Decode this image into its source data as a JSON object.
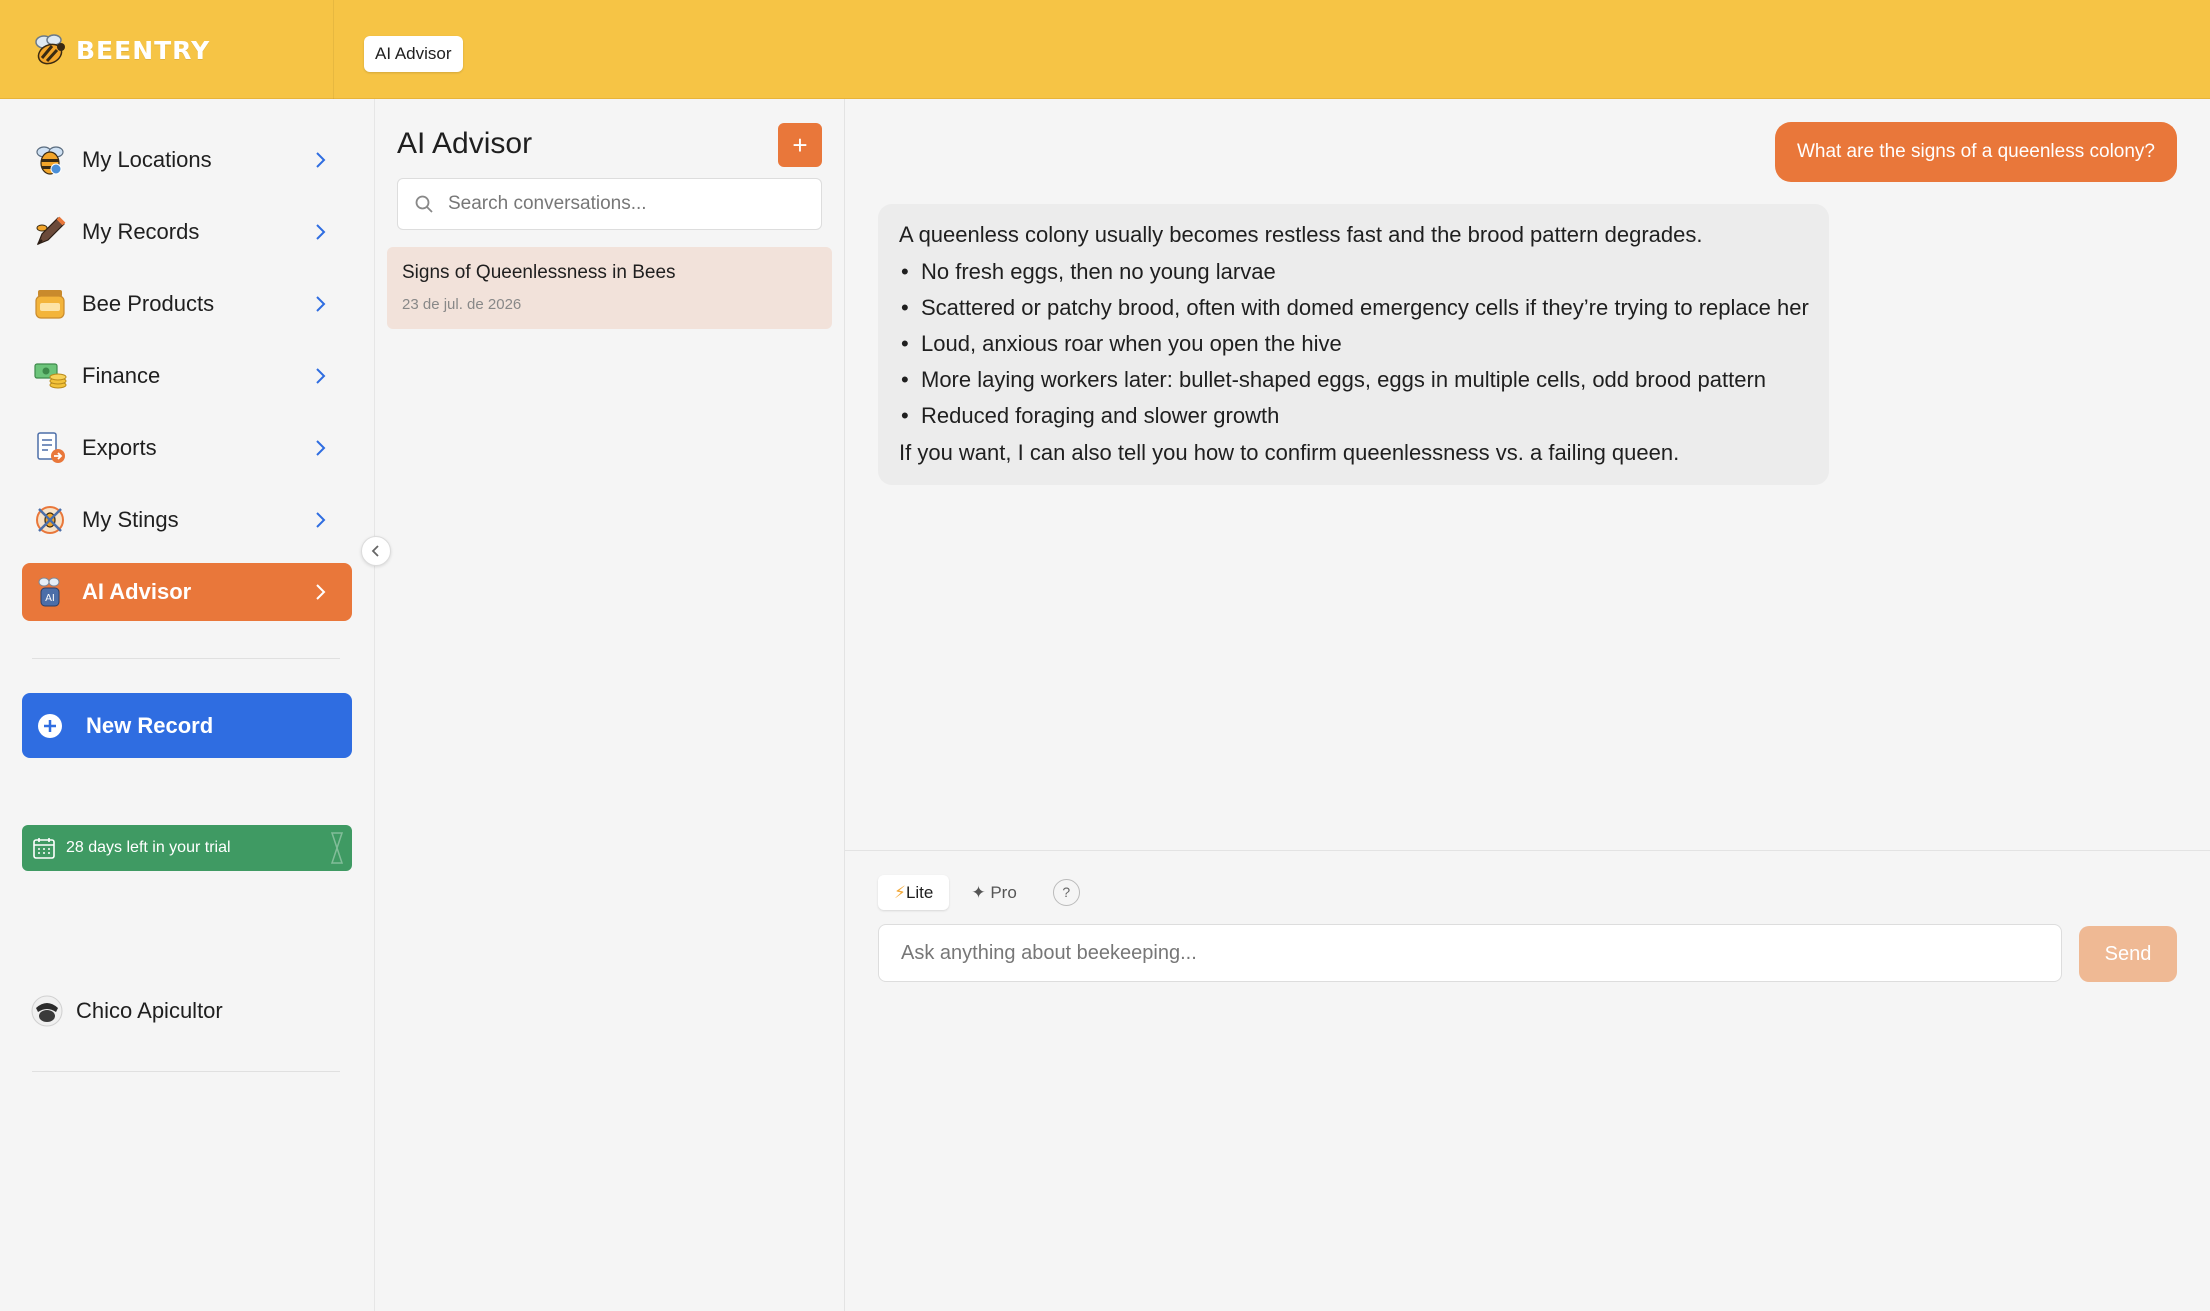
{
  "app": {
    "logo_text": "BEENTRY",
    "breadcrumb": "AI Advisor"
  },
  "sidebar": {
    "items": [
      {
        "label": "My Locations",
        "icon": "bee-map-icon"
      },
      {
        "label": "My Records",
        "icon": "pen-icon"
      },
      {
        "label": "Bee Products",
        "icon": "honey-jar-icon"
      },
      {
        "label": "Finance",
        "icon": "money-icon"
      },
      {
        "label": "Exports",
        "icon": "export-doc-icon"
      },
      {
        "label": "My Stings",
        "icon": "sting-icon"
      },
      {
        "label": "AI Advisor",
        "icon": "ai-bee-icon",
        "active": true
      }
    ],
    "new_record_label": "New Record",
    "trial_text": "28 days left in your trial",
    "user_name": "Chico Apicultor"
  },
  "conversations": {
    "title": "AI Advisor",
    "add_label": "+",
    "search_placeholder": "Search conversations...",
    "items": [
      {
        "title": "Signs of Queenlessness in Bees",
        "date": "23 de jul. de 2026"
      }
    ]
  },
  "chat": {
    "user_message": "What are the signs of a queenless colony?",
    "ai_intro": "A queenless colony usually becomes restless fast and the brood pattern degrades.",
    "ai_points": [
      "No fresh eggs, then no young larvae",
      "Scattered or patchy brood, often with domed emergency cells if they’re trying to replace her",
      "Loud, anxious roar when you open the hive",
      "More laying workers later: bullet-shaped eggs, eggs in multiple cells, odd brood pattern",
      "Reduced foraging and slower growth"
    ],
    "ai_outro": "If you want, I can also tell you how to confirm queenlessness vs. a failing queen."
  },
  "composer": {
    "mode_lite": "Lite",
    "mode_pro": "Pro",
    "help_label": "?",
    "input_placeholder": "Ask anything about beekeeping...",
    "send_label": "Send"
  },
  "colors": {
    "topbar": "#f6c445",
    "accent": "#e9773a",
    "primary_blue": "#2f6de1",
    "trial_green": "#3f9a63"
  }
}
